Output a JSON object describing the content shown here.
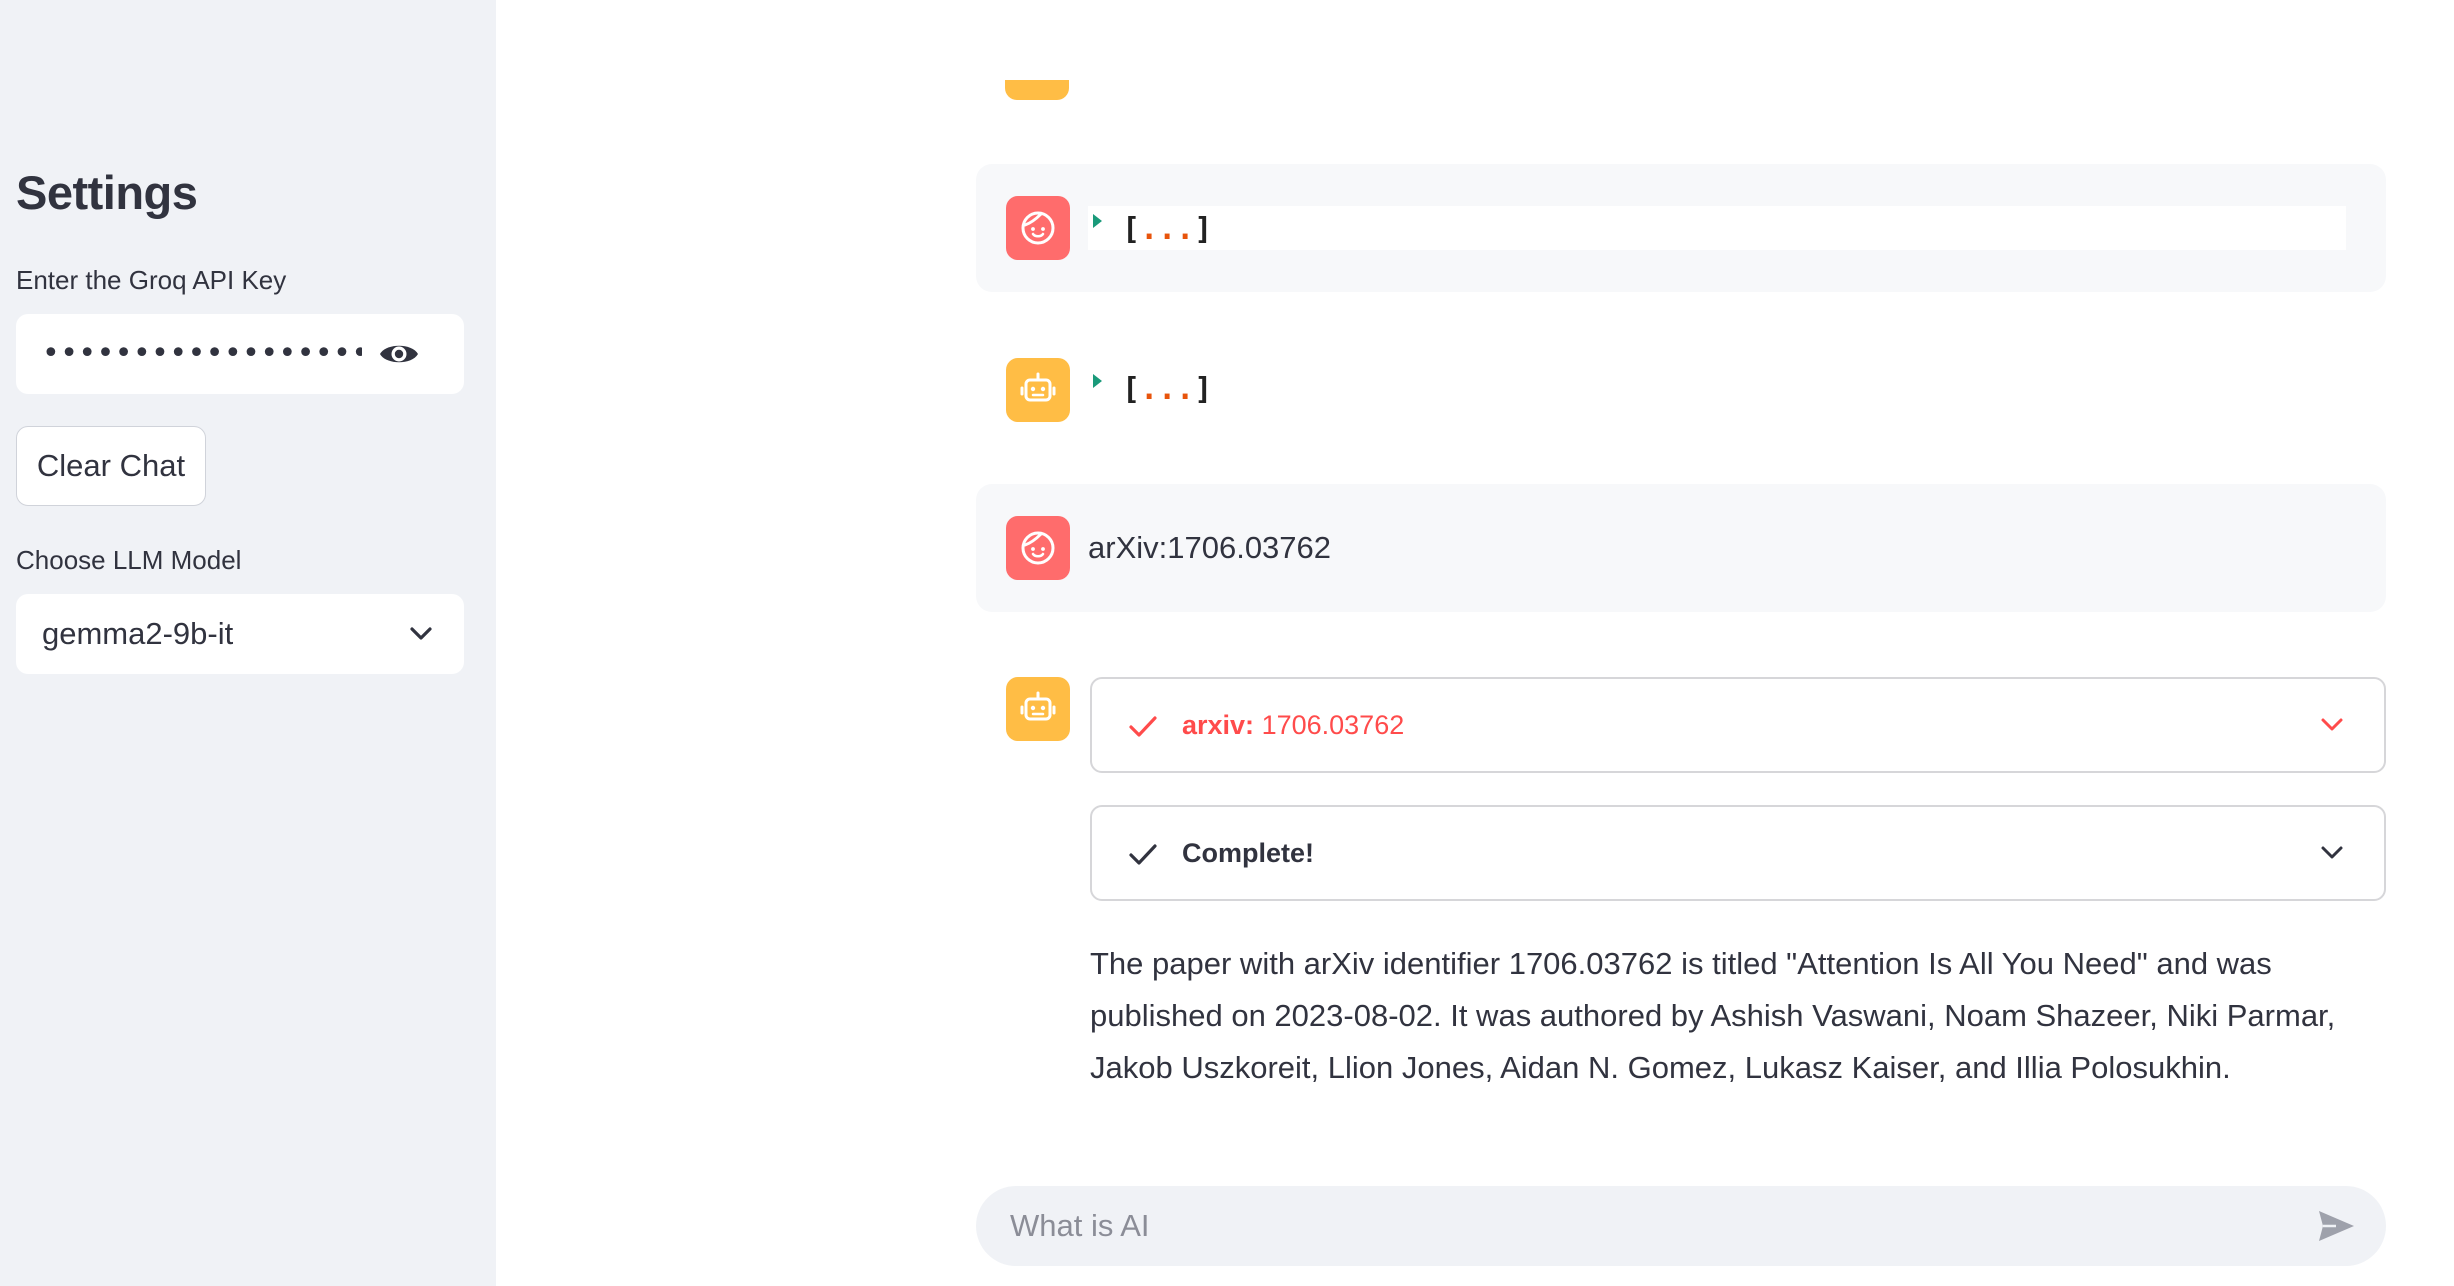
{
  "sidebar": {
    "title": "Settings",
    "api_key_label": "Enter the Groq API Key",
    "api_key_value": "••••••••••••••••••••••••••••••••••••••",
    "clear_button": "Clear Chat",
    "model_label": "Choose LLM Model",
    "model_selected": "gemma2-9b-it"
  },
  "chat": {
    "messages": [
      {
        "role": "user",
        "type": "json",
        "open": "[",
        "dots": "...",
        "close": "]"
      },
      {
        "role": "assistant",
        "type": "json",
        "open": "[",
        "dots": "...",
        "close": "]"
      },
      {
        "role": "user",
        "type": "text",
        "text": "arXiv:1706.03762"
      },
      {
        "role": "assistant",
        "type": "tool",
        "tool_steps": [
          {
            "label": "arxiv:",
            "detail": "1706.03762",
            "status": "complete",
            "color": "#ff4b4b"
          },
          {
            "label": "Complete!",
            "detail": "",
            "status": "complete",
            "color": "#31333f"
          }
        ],
        "answer": "The paper with arXiv identifier 1706.03762 is titled \"Attention Is All You Need\" and was published on 2023-08-02. It was authored by Ashish Vaswani, Noam Shazeer, Niki Parmar, Jakob Uszkoreit, Llion Jones, Aidan N. Gomez, Lukasz Kaiser, and Illia Polosukhin."
      }
    ],
    "input_placeholder": "What is AI"
  },
  "colors": {
    "user_avatar": "#ff6c6c",
    "assistant_avatar": "#ffbd45",
    "accent_red": "#ff4b4b",
    "sidebar_bg": "#f0f2f6"
  },
  "icons": {
    "user_avatar": "smiling-face-icon",
    "assistant_avatar": "robot-face-icon",
    "password_toggle": "eye-icon",
    "select": "chevron-down-icon",
    "json_toggle": "caret-right-icon",
    "step_status": "check-icon",
    "send": "send-icon"
  }
}
